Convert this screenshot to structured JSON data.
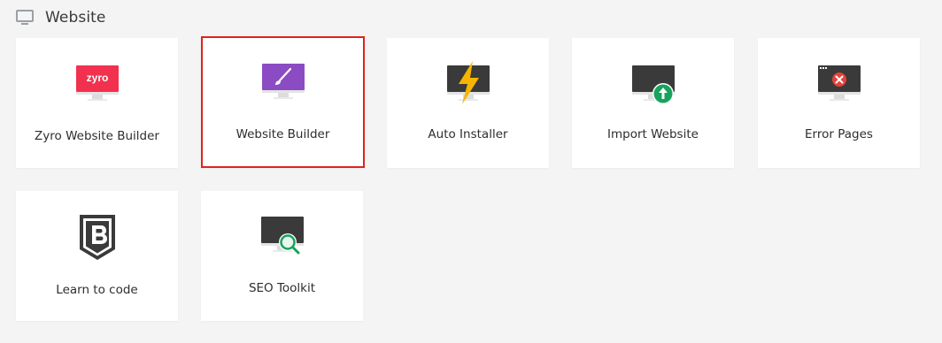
{
  "section": {
    "title": "Website",
    "icon": "monitor-icon"
  },
  "tiles": [
    {
      "label": "Zyro Website Builder",
      "icon": "zyro-monitor-icon",
      "brand_text": "zyro"
    },
    {
      "label": "Website Builder",
      "icon": "paintbrush-monitor-icon",
      "selected": true
    },
    {
      "label": "Auto Installer",
      "icon": "lightning-monitor-icon"
    },
    {
      "label": "Import Website",
      "icon": "upload-monitor-icon"
    },
    {
      "label": "Error Pages",
      "icon": "error-monitor-icon"
    },
    {
      "label": "Learn to code",
      "icon": "shield-b-icon"
    },
    {
      "label": "SEO Toolkit",
      "icon": "magnifier-monitor-icon"
    }
  ],
  "colors": {
    "background": "#f4f4f4",
    "tile": "#ffffff",
    "selection_border": "#e0231b",
    "zyro_red": "#f2314f",
    "builder_purple": "#8b4bc2",
    "screen_dark": "#3a3a3a",
    "bolt_yellow": "#f6b500",
    "upload_green": "#17a35d",
    "error_red": "#e8413b"
  }
}
